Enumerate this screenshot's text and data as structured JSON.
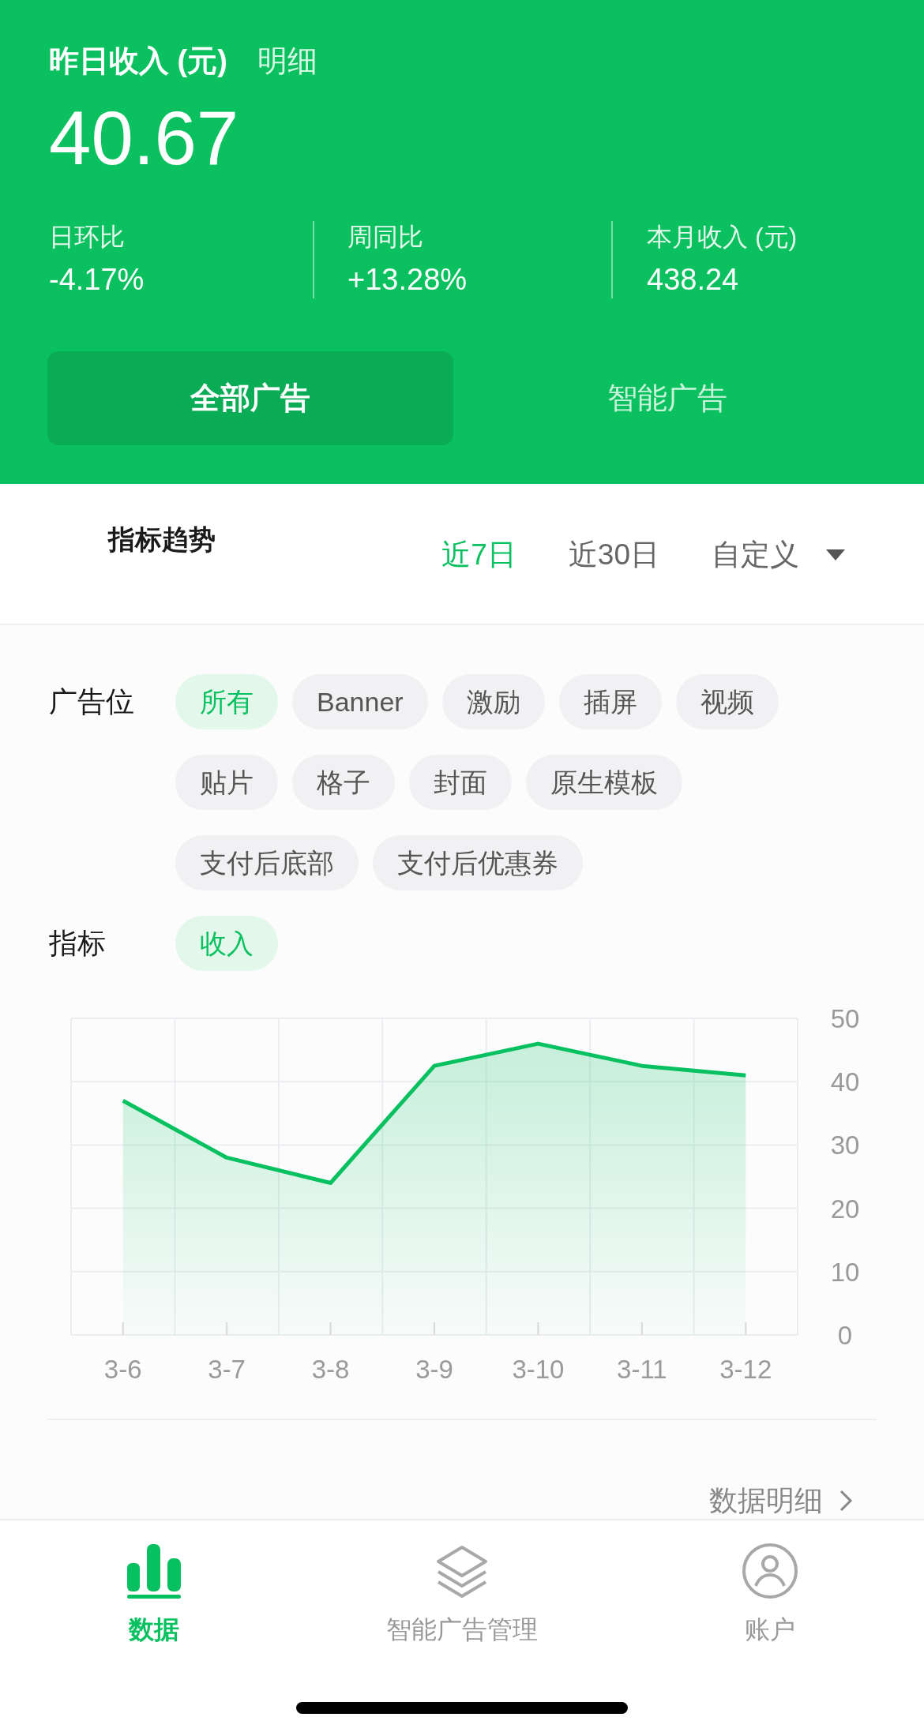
{
  "header": {
    "title": "昨日收入 (元)",
    "detail_link": "明细",
    "amount": "40.67",
    "stats": [
      {
        "label": "日环比",
        "value": "-4.17%"
      },
      {
        "label": "周同比",
        "value": "+13.28%"
      },
      {
        "label": "本月收入 (元)",
        "value": "438.24"
      }
    ],
    "ad_tabs": [
      {
        "label": "全部广告",
        "selected": true
      },
      {
        "label": "智能广告",
        "selected": false
      }
    ]
  },
  "trend": {
    "title": "指标趋势",
    "ranges": [
      {
        "label": "近7日",
        "selected": true,
        "kind": "plain"
      },
      {
        "label": "近30日",
        "selected": false,
        "kind": "plain"
      },
      {
        "label": "自定义",
        "selected": false,
        "kind": "dropdown"
      }
    ]
  },
  "filters": [
    {
      "label": "广告位",
      "chips": [
        {
          "label": "所有",
          "selected": true
        },
        {
          "label": "Banner",
          "selected": false
        },
        {
          "label": "激励",
          "selected": false
        },
        {
          "label": "插屏",
          "selected": false
        },
        {
          "label": "视频",
          "selected": false
        },
        {
          "label": "贴片",
          "selected": false
        },
        {
          "label": "格子",
          "selected": false
        },
        {
          "label": "封面",
          "selected": false
        },
        {
          "label": "原生模板",
          "selected": false
        },
        {
          "label": "支付后底部",
          "selected": false
        },
        {
          "label": "支付后优惠券",
          "selected": false
        }
      ]
    },
    {
      "label": "指标",
      "chips": [
        {
          "label": "收入",
          "selected": true
        }
      ]
    }
  ],
  "chart_data": {
    "type": "area",
    "categories": [
      "3-6",
      "3-7",
      "3-8",
      "3-9",
      "3-10",
      "3-11",
      "3-12"
    ],
    "series": [
      {
        "color": "#07c160",
        "values": [
          37,
          28,
          24,
          42.5,
          46,
          42.5,
          41
        ]
      }
    ],
    "ylim": [
      0,
      50
    ],
    "yticks": [
      0,
      10,
      20,
      30,
      40,
      50
    ],
    "grid": true
  },
  "detail_link": "数据明细",
  "bottom_nav": [
    {
      "label": "数据",
      "kind": "chart",
      "selected": true
    },
    {
      "label": "智能广告管理",
      "kind": "layers",
      "selected": false
    },
    {
      "label": "账户",
      "kind": "account",
      "selected": false
    }
  ]
}
